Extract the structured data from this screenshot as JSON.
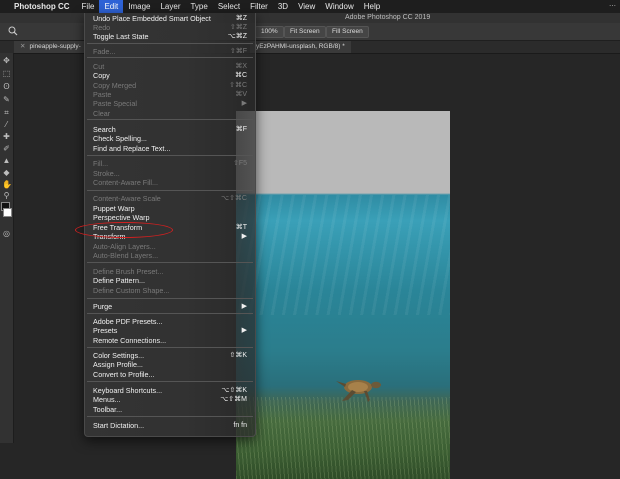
{
  "menubar": {
    "app_name": "Photoshop CC",
    "items": [
      "File",
      "Edit",
      "Image",
      "Layer",
      "Type",
      "Select",
      "Filter",
      "3D",
      "View",
      "Window",
      "Help"
    ],
    "active": "Edit"
  },
  "window": {
    "title": "Adobe Photoshop CC 2019"
  },
  "options_bar": {
    "zoom_percent": "100%",
    "fit_screen": "Fit Screen",
    "fill_screen": "Fill Screen"
  },
  "tabs": [
    {
      "label": "pineapple-supply-"
    },
    {
      "label": "yEzPAHMI-unsplash, RGB/8) *"
    }
  ],
  "edit_menu": {
    "items": [
      {
        "label": "Undo Place Embedded Smart Object",
        "shortcut": "⌘Z",
        "enabled": true
      },
      {
        "label": "Redo",
        "shortcut": "⇧⌘Z",
        "enabled": false
      },
      {
        "label": "Toggle Last State",
        "shortcut": "⌥⌘Z",
        "enabled": true
      },
      {
        "label": "Fade...",
        "shortcut": "⇧⌘F",
        "enabled": false
      },
      {
        "label": "Cut",
        "shortcut": "⌘X",
        "enabled": false
      },
      {
        "label": "Copy",
        "shortcut": "⌘C",
        "enabled": true
      },
      {
        "label": "Copy Merged",
        "shortcut": "⇧⌘C",
        "enabled": false
      },
      {
        "label": "Paste",
        "shortcut": "⌘V",
        "enabled": false
      },
      {
        "label": "Paste Special",
        "shortcut": "",
        "enabled": false,
        "submenu": true
      },
      {
        "label": "Clear",
        "shortcut": "",
        "enabled": false
      },
      {
        "label": "Search",
        "shortcut": "⌘F",
        "enabled": true
      },
      {
        "label": "Check Spelling...",
        "shortcut": "",
        "enabled": true
      },
      {
        "label": "Find and Replace Text...",
        "shortcut": "",
        "enabled": true
      },
      {
        "label": "Fill...",
        "shortcut": "⇧F5",
        "enabled": false
      },
      {
        "label": "Stroke...",
        "shortcut": "",
        "enabled": false
      },
      {
        "label": "Content-Aware Fill...",
        "shortcut": "",
        "enabled": false
      },
      {
        "label": "Content-Aware Scale",
        "shortcut": "⌥⇧⌘C",
        "enabled": false
      },
      {
        "label": "Puppet Warp",
        "shortcut": "",
        "enabled": true
      },
      {
        "label": "Perspective Warp",
        "shortcut": "",
        "enabled": true
      },
      {
        "label": "Free Transform",
        "shortcut": "⌘T",
        "enabled": true
      },
      {
        "label": "Transform",
        "shortcut": "",
        "enabled": true,
        "submenu": true
      },
      {
        "label": "Auto-Align Layers...",
        "shortcut": "",
        "enabled": false
      },
      {
        "label": "Auto-Blend Layers...",
        "shortcut": "",
        "enabled": false
      },
      {
        "label": "Define Brush Preset...",
        "shortcut": "",
        "enabled": false
      },
      {
        "label": "Define Pattern...",
        "shortcut": "",
        "enabled": true
      },
      {
        "label": "Define Custom Shape...",
        "shortcut": "",
        "enabled": false
      },
      {
        "label": "Purge",
        "shortcut": "",
        "enabled": true,
        "submenu": true
      },
      {
        "label": "Adobe PDF Presets...",
        "shortcut": "",
        "enabled": true
      },
      {
        "label": "Presets",
        "shortcut": "",
        "enabled": true,
        "submenu": true
      },
      {
        "label": "Remote Connections...",
        "shortcut": "",
        "enabled": true
      },
      {
        "label": "Color Settings...",
        "shortcut": "⇧⌘K",
        "enabled": true
      },
      {
        "label": "Assign Profile...",
        "shortcut": "",
        "enabled": true
      },
      {
        "label": "Convert to Profile...",
        "shortcut": "",
        "enabled": true
      },
      {
        "label": "Keyboard Shortcuts...",
        "shortcut": "⌥⇧⌘K",
        "enabled": true
      },
      {
        "label": "Menus...",
        "shortcut": "⌥⇧⌘M",
        "enabled": true
      },
      {
        "label": "Toolbar...",
        "shortcut": "",
        "enabled": true
      },
      {
        "label": "Start Dictation...",
        "shortcut": "fn fn",
        "enabled": true
      }
    ],
    "highlighted": "Free Transform"
  },
  "colors": {
    "menubar_active": "#2e62d6",
    "annotation": "#d02020",
    "water": "#3aa0b8",
    "seagrass": "#466b3e"
  },
  "icons": [
    "zoom-icon",
    "move-icon",
    "marquee-icon",
    "lasso-icon",
    "quick-select-icon",
    "crop-icon",
    "eyedropper-icon",
    "healing-icon",
    "brush-icon",
    "stamp-icon",
    "history-brush-icon",
    "eraser-icon",
    "gradient-icon",
    "blur-icon",
    "dodge-icon",
    "pen-icon",
    "type-icon",
    "path-select-icon",
    "shape-icon",
    "hand-icon",
    "zoom-tool-icon"
  ]
}
